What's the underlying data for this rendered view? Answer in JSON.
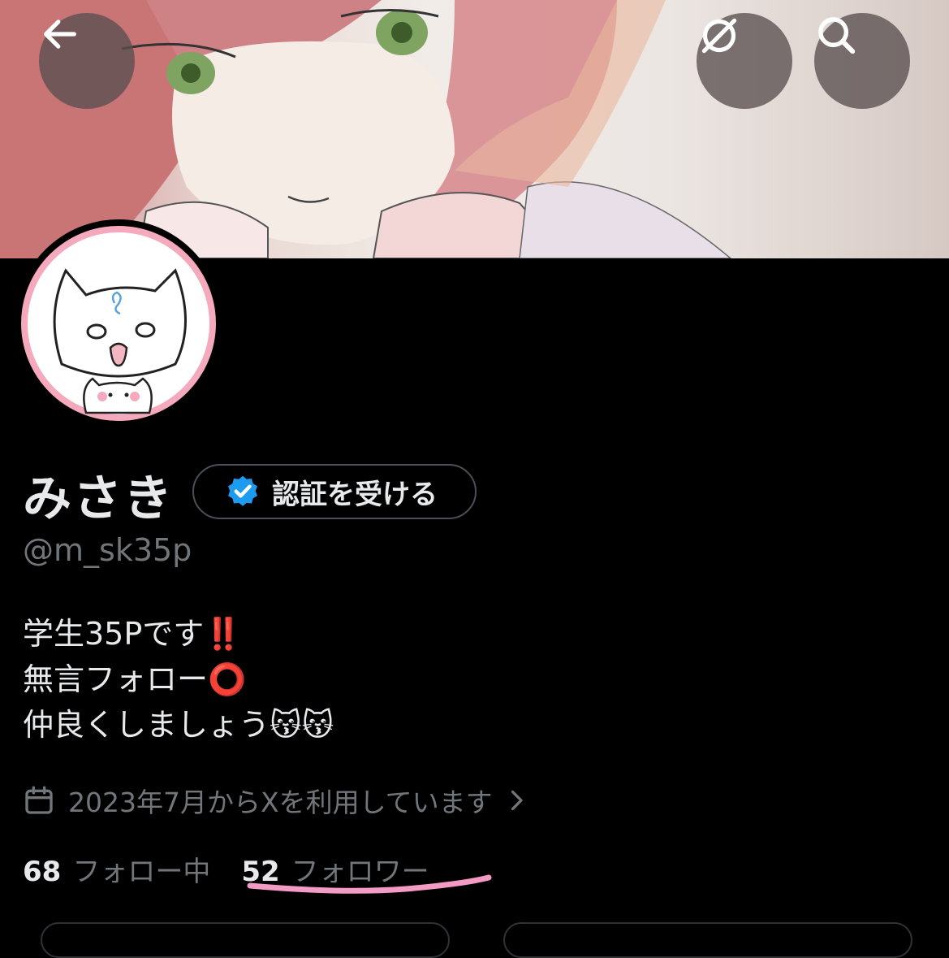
{
  "header": {
    "back_icon": "arrow-left-icon",
    "explore_icon": "explore-compass-icon",
    "search_icon": "search-icon"
  },
  "profile": {
    "display_name": "みさき",
    "verify_button_label": "認証を受ける",
    "verify_icon": "verified-badge-icon",
    "handle": "@m_sk35p",
    "bio_lines": [
      "学生35Pです‼️",
      "無言フォロー⭕",
      "仲良くしましょう😽😽"
    ],
    "joined_text": "2023年7月からXを利用しています",
    "joined_icon": "calendar-icon",
    "following_count": "68",
    "following_label": "フォロー中",
    "followers_count": "52",
    "followers_label": "フォロワー"
  },
  "colors": {
    "background": "#000000",
    "text_primary": "#e7e9ea",
    "text_secondary": "#71767b",
    "verified_blue": "#1d9bf0",
    "annotation_pink": "#f39bc4",
    "avatar_ring_pink": "#f4a9bd"
  }
}
